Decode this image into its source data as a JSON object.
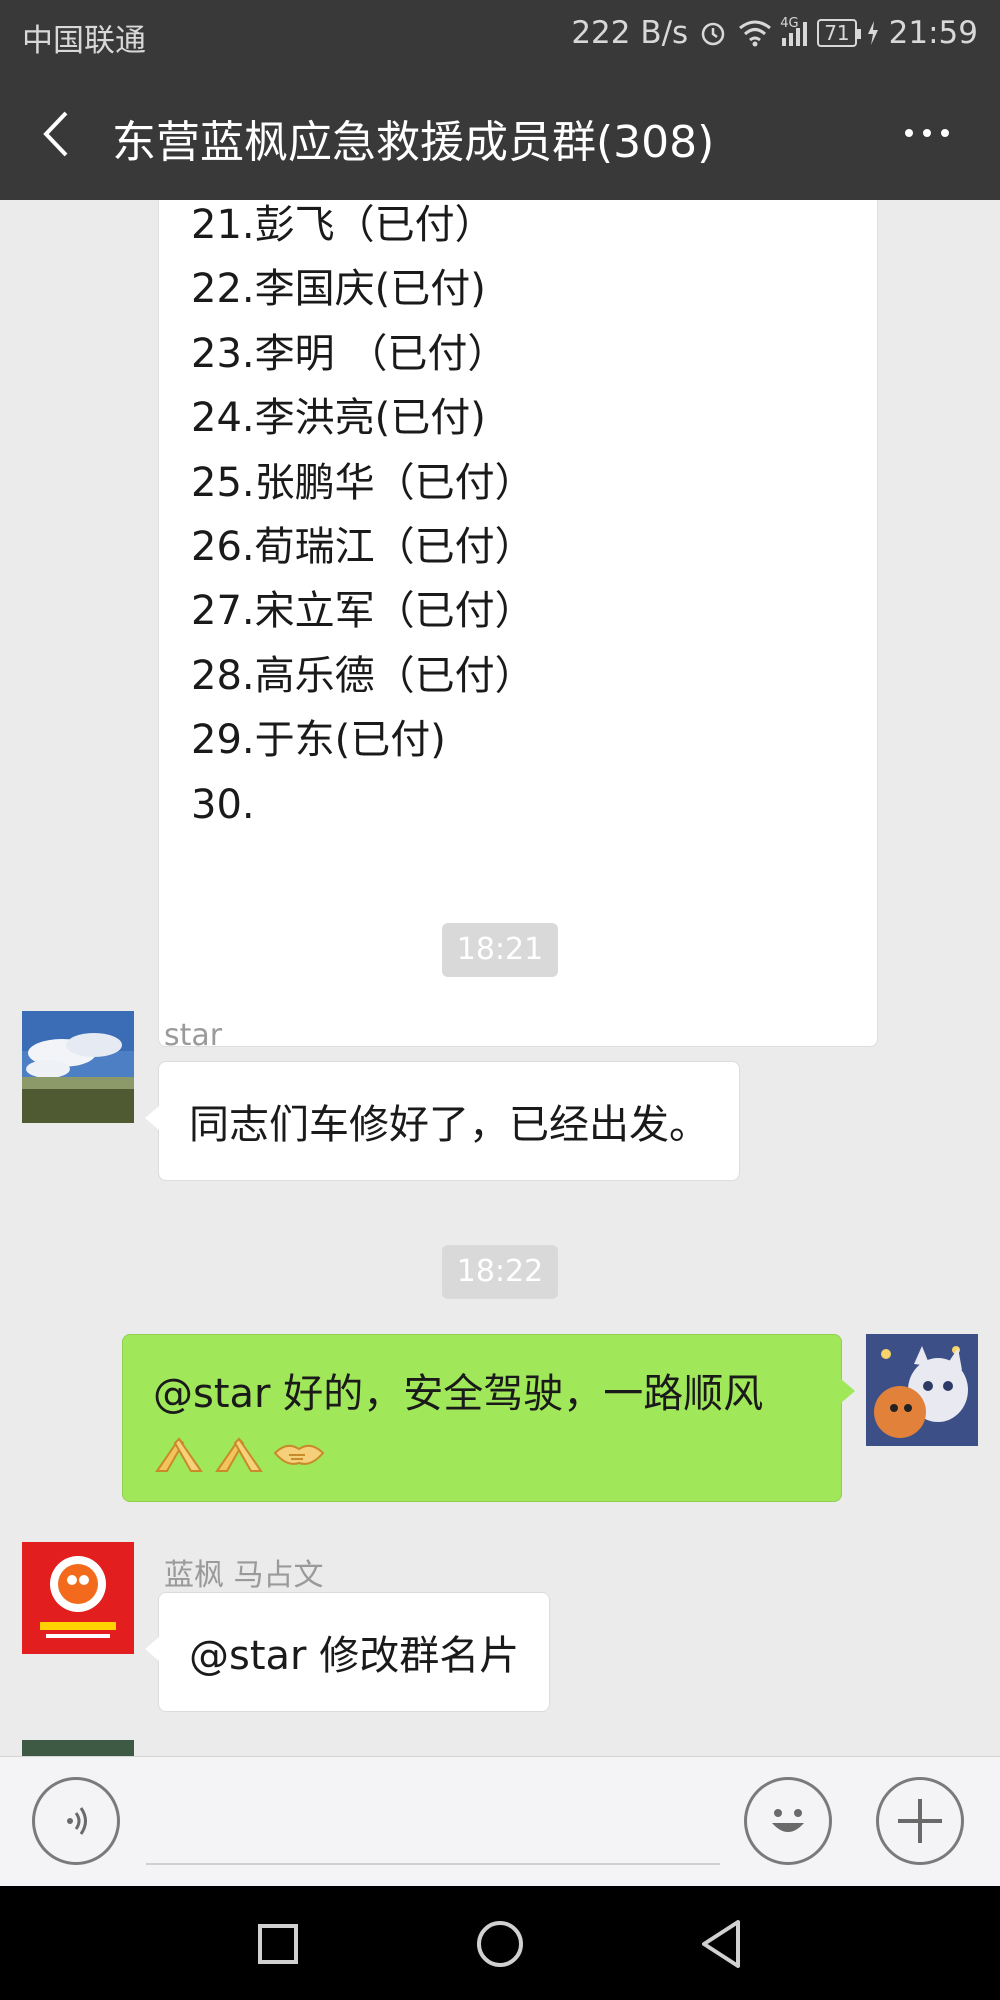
{
  "status_bar": {
    "carrier": "中国联通",
    "speed": "222 B/s",
    "network": "4G",
    "battery": "71",
    "time": "21:59"
  },
  "header": {
    "title": "东营蓝枫应急救援成员群(308)",
    "back_icon": "chevron-left-icon",
    "more_icon": "more-dots-icon"
  },
  "chat": {
    "list_message": {
      "lines": [
        "21.彭飞（已付）",
        "22.李国庆(已付)",
        "23.李明 （已付）",
        "24.李洪亮(已付)",
        "25.张鹏华（已付）",
        "26.荀瑞江（已付）",
        "27.宋立军（已付）",
        "28.高乐德（已付）",
        "29.于东(已付)",
        "30."
      ]
    },
    "time_1": "18:21",
    "msg_1": {
      "sender": "star",
      "text": "同志们车修好了，已经出发。"
    },
    "time_2": "18:22",
    "msg_2": {
      "text": "@star  好的，安全驾驶，一路顺风",
      "emojis": [
        "pray-icon",
        "pray-icon",
        "handshake-icon"
      ]
    },
    "msg_3": {
      "sender": "蓝枫 马占文",
      "text": "@star  修改群名片"
    }
  },
  "input_bar": {
    "voice_icon": "voice-icon",
    "emoji_icon": "smiley-icon",
    "add_icon": "plus-icon",
    "placeholder": ""
  },
  "nav_bar": {
    "recent_icon": "square-icon",
    "home_icon": "circle-icon",
    "back_icon": "triangle-back-icon"
  },
  "colors": {
    "header_bg": "#393939",
    "chat_bg": "#ebebeb",
    "my_bubble": "#a0e75a",
    "time_chip": "#d9d9d9"
  }
}
